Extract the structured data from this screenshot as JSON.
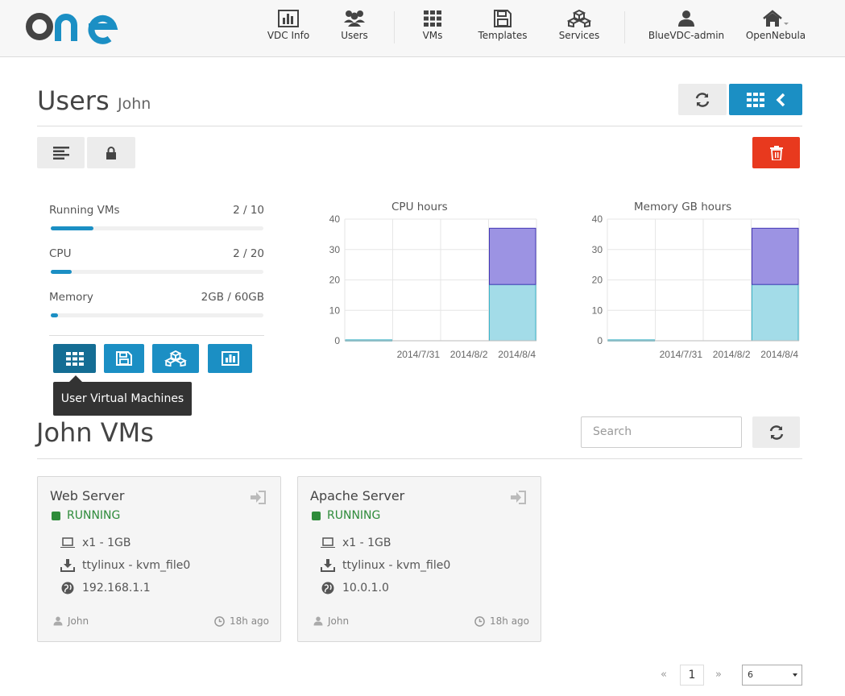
{
  "brand": {
    "logo_text": "one"
  },
  "nav": {
    "vdc_info": "VDC Info",
    "users": "Users",
    "vms": "VMs",
    "templates": "Templates",
    "services": "Services",
    "user": "BlueVDC-admin",
    "zone": "OpenNebula"
  },
  "header": {
    "title": "Users",
    "subtitle": "John"
  },
  "quotas": [
    {
      "label": "Running VMs",
      "value": "2 / 10",
      "fraction": 0.2
    },
    {
      "label": "CPU",
      "value": "2 / 20",
      "fraction": 0.1
    },
    {
      "label": "Memory",
      "value": "2GB / 60GB",
      "fraction": 0.033
    }
  ],
  "tooltip": "User Virtual Machines",
  "chart_data": [
    {
      "type": "bar",
      "title": "CPU hours",
      "ylim": [
        0,
        40
      ],
      "yticks": [
        "0",
        "10",
        "20",
        "30",
        "40"
      ],
      "xticks": [
        "2014/7/31",
        "2014/8/2",
        "2014/8/4"
      ],
      "series": [
        {
          "values": [
            0.3,
            0,
            0,
            18.5
          ]
        },
        {
          "values": [
            0,
            0,
            0,
            18.5
          ]
        }
      ],
      "colors": [
        "#a3dce8",
        "#9c93e3"
      ],
      "grid": true
    },
    {
      "type": "bar",
      "title": "Memory GB hours",
      "ylim": [
        0,
        40
      ],
      "yticks": [
        "0",
        "10",
        "20",
        "30",
        "40"
      ],
      "xticks": [
        "2014/7/31",
        "2014/8/2",
        "2014/8/4"
      ],
      "series": [
        {
          "values": [
            0.3,
            0,
            0,
            18.5
          ]
        },
        {
          "values": [
            0,
            0,
            0,
            18.5
          ]
        }
      ],
      "colors": [
        "#a3dce8",
        "#9c93e3"
      ],
      "grid": true
    }
  ],
  "vms_section": {
    "title": "John VMs",
    "search_placeholder": "Search"
  },
  "vms": [
    {
      "name": "Web Server",
      "state": "RUNNING",
      "size": "x1 - 1GB",
      "image": "ttylinux - kvm_file0",
      "ip": "192.168.1.1",
      "owner": "John",
      "age": "18h ago"
    },
    {
      "name": "Apache Server",
      "state": "RUNNING",
      "size": "x1 - 1GB",
      "image": "ttylinux - kvm_file0",
      "ip": "10.0.1.0",
      "owner": "John",
      "age": "18h ago"
    }
  ],
  "pagination": {
    "prev": "«",
    "current": "1",
    "next": "»",
    "page_size": "6"
  },
  "colors": {
    "accent": "#1b8fc4",
    "danger": "#e8391e",
    "running": "#2e8b3a"
  }
}
